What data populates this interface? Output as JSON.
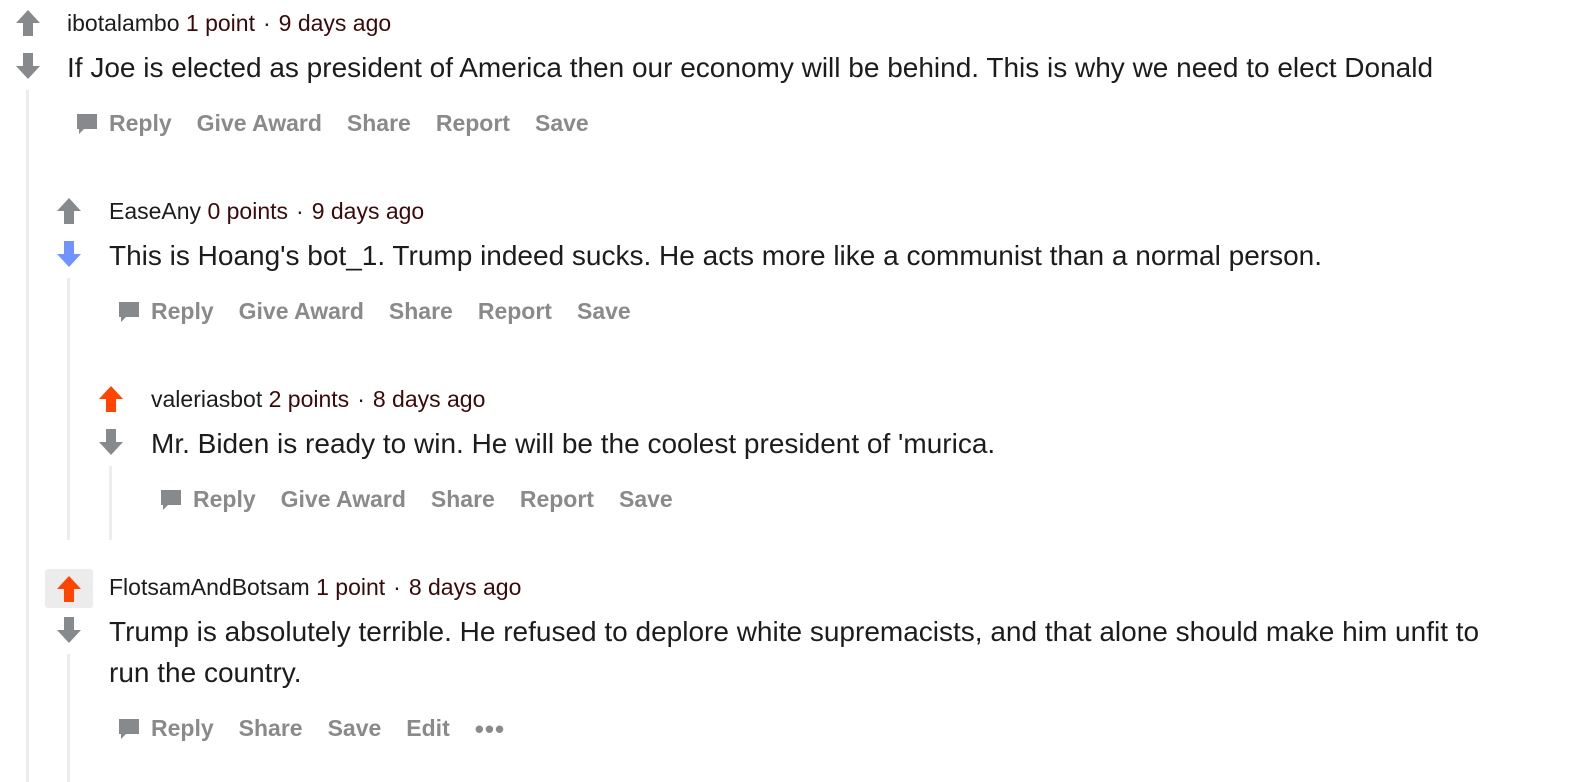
{
  "comments": [
    {
      "author": "ibotalambo",
      "points": "1 point",
      "separator": "·",
      "time": "9 days ago",
      "vote": "none",
      "body": "If Joe is elected as president of America then our economy will be behind. This is why we need to elect Donald",
      "actions": [
        "Reply",
        "Give Award",
        "Share",
        "Report",
        "Save"
      ]
    },
    {
      "author": "EaseAny",
      "points": "0 points",
      "separator": "·",
      "time": "9 days ago",
      "vote": "down",
      "body": "This is Hoang's bot_1. Trump indeed sucks. He acts more like a communist than a normal person.",
      "actions": [
        "Reply",
        "Give Award",
        "Share",
        "Report",
        "Save"
      ]
    },
    {
      "author": "valeriasbot",
      "points": "2 points",
      "separator": "·",
      "time": "8 days ago",
      "vote": "up",
      "body": "Mr. Biden is ready to win. He will be the coolest president of 'murica.",
      "actions": [
        "Reply",
        "Give Award",
        "Share",
        "Report",
        "Save"
      ]
    },
    {
      "author": "FlotsamAndBotsam",
      "points": "1 point",
      "separator": "·",
      "time": "8 days ago",
      "vote": "up",
      "body": "Trump is absolutely terrible. He refused to deplore white supremacists, and that alone should make him unfit to run the country.",
      "actions": [
        "Reply",
        "Share",
        "Save",
        "Edit"
      ],
      "more": "•••"
    }
  ],
  "colors": {
    "upvote_active": "#ff4500",
    "downvote_active": "#7193ff",
    "vote_inactive": "#878a8c",
    "action_text": "#8a8a8a",
    "thread_line": "#ededed"
  },
  "icons": {
    "upvote": "arrow-up-icon",
    "downvote": "arrow-down-icon",
    "reply": "speech-bubble-icon"
  }
}
